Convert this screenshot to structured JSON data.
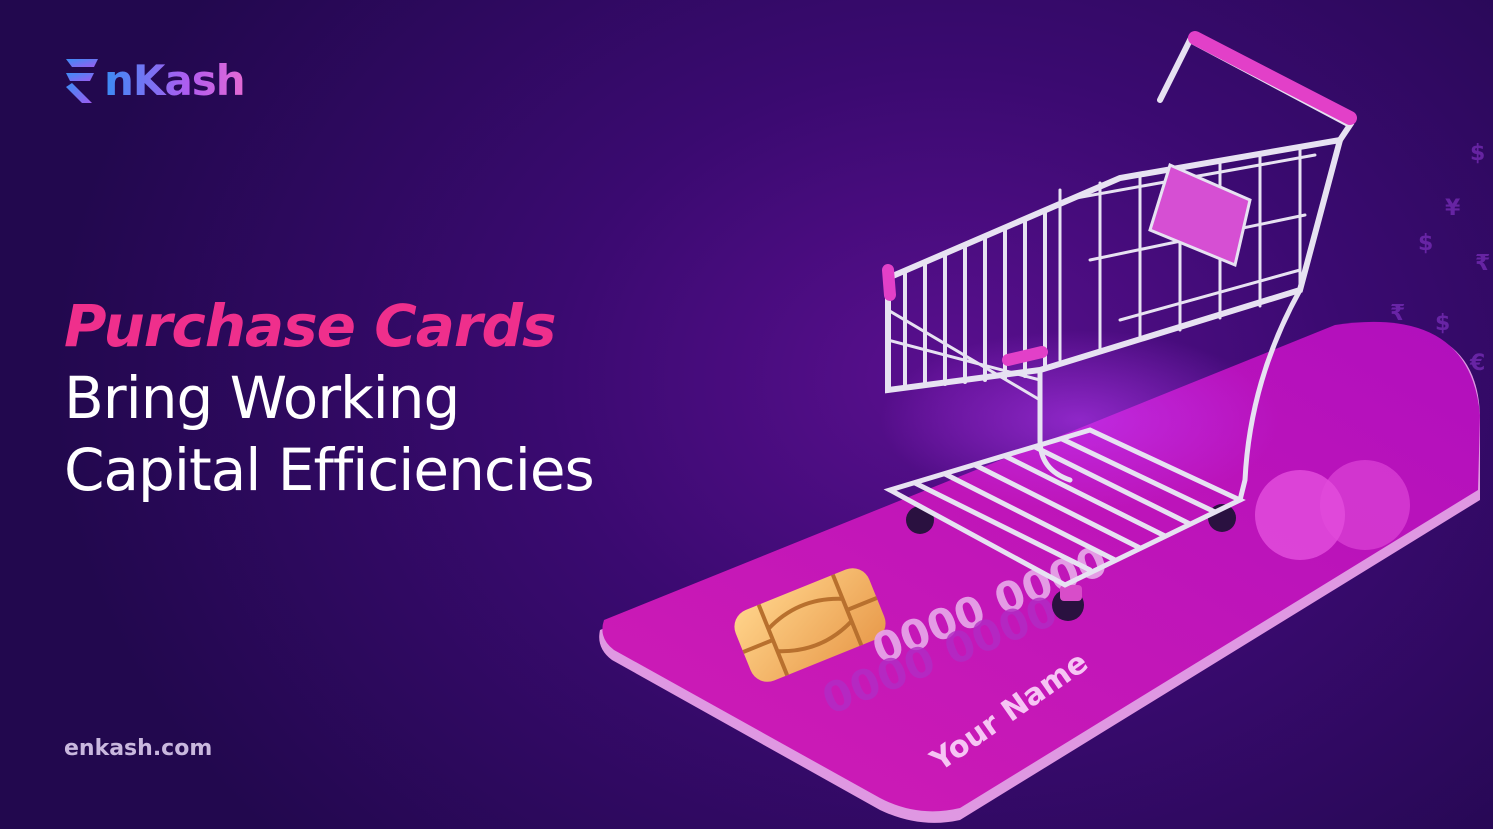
{
  "brand": {
    "name": "EnKash",
    "logo_text": "nKash",
    "website": "enkash.com"
  },
  "headline": {
    "accent": "Purchase Cards",
    "line1": "Bring Working",
    "line2": "Capital Efficiencies"
  },
  "card": {
    "number_front": "0000 0000",
    "number_back": "0000 0000",
    "holder": "Your Name"
  },
  "colors": {
    "accent_pink": "#ef2f8c",
    "card_magenta": "#d11ab8",
    "background": "#3a0a70",
    "chip": "#f5b86a"
  },
  "icons": [
    "enkash-logo-icon",
    "shopping-cart-icon",
    "credit-card-icon",
    "chip-icon",
    "currency-symbols-icon"
  ]
}
